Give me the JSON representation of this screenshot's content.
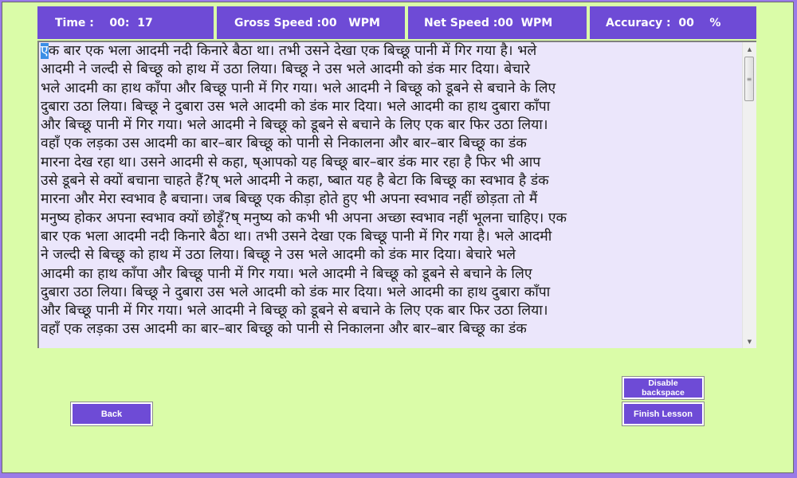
{
  "stats": {
    "time": "Time :    00:  17",
    "gross_speed": "Gross Speed :00   WPM",
    "net_speed": "Net Speed :00  WPM",
    "accuracy": "Accuracy :  00    %"
  },
  "passage": {
    "cursor_char": "ए",
    "lines": [
      "क बार एक भला आदमी नदी किनारे बैठा था। तभी उसने देखा एक बिच्छू पानी में गिर गया है। भले",
      "आदमी ने जल्दी से बिच्छू को हाथ में उठा लिया। बिच्छू ने उस भले आदमी को डंक मार दिया। बेचारे",
      "भले आदमी का हाथ कॉंपा और बिच्छू पानी में गिर गया। भले आदमी ने बिच्छू को डूबने से बचाने के लिए",
      "दुबारा उठा लिया। बिच्छू ने दुबारा उस भले आदमी को डंक मार दिया। भले आदमी का हाथ दुबारा कॉंपा",
      "और बिच्छू पानी में गिर गया। भले आदमी ने बिच्छू को डूबने से बचाने के लिए एक बार फिर उठा लिया।",
      "वहॉं एक लड़का उस आदमी का बार–बार बिच्छू को पानी से निकालना और बार–बार बिच्छू का डंक",
      "मारना देख रहा था। उसने आदमी से कहा, ष्आपको यह बिच्छू बार–बार डंक मार रहा है फिर भी आप",
      "उसे डूबने से क्यों बचाना चाहते हैं?ष् भले आदमी ने कहा, ष्बात यह है बेटा कि बिच्छू का स्वभाव है डंक",
      "मारना और मेरा स्वभाव है बचाना। जब बिच्छू एक कीड़ा होते हुए भी अपना स्वभाव नहीं छोड़ता तो मैं",
      "मनुष्य होकर अपना स्वभाव क्यों छोड़ूँ?ष् मनुष्य को कभी भी अपना अच्छा स्वभाव नहीं भूलना चाहिए।  एक",
      "बार एक भला आदमी नदी किनारे बैठा था। तभी उसने देखा एक बिच्छू पानी में गिर गया है। भले आदमी",
      "ने जल्दी से बिच्छू को हाथ में उठा लिया। बिच्छू ने उस भले आदमी को डंक मार दिया। बेचारे भले",
      "आदमी का हाथ कॉंपा और बिच्छू पानी में गिर गया। भले आदमी ने बिच्छू को डूबने से बचाने के लिए",
      "दुबारा उठा लिया। बिच्छू ने दुबारा उस भले आदमी को डंक मार दिया। भले आदमी का हाथ दुबारा कॉंपा",
      "और बिच्छू पानी में गिर गया। भले आदमी ने बिच्छू को डूबने से बचाने के लिए एक बार फिर उठा लिया।",
      "वहॉं एक लड़का उस आदमी का बार–बार बिच्छू को पानी से निकालना और बार–बार बिच्छू का डंक"
    ]
  },
  "scrollbar": {
    "up_icon": "▲",
    "down_icon": "▼",
    "grip_icon": "≡"
  },
  "buttons": {
    "back": "Back",
    "disable_backspace": "Disable backspace",
    "finish_lesson": "Finish Lesson"
  }
}
